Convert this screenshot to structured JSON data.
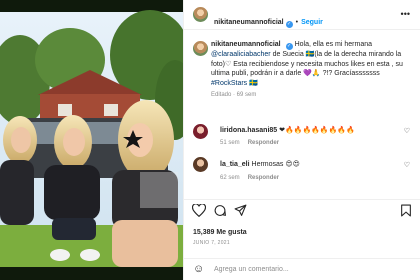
{
  "post": {
    "username": "nikitaneumannoficial",
    "follow_label": "Seguir",
    "more_label": "•••",
    "caption_prefix": "Hola, ella es mi hermana",
    "caption_mention": "@claraaliciabacher",
    "caption_rest": "de Suecia 🇸🇪(la de la derecha mirando la foto)♡ Esta recibiendose y necesita muchos likes en esta , su ultima publi, podrán ir a darle 💜🙏 ?!? Gracíasssssss",
    "caption_hashtag": "#RockStars",
    "caption_end": "🇸🇪",
    "edited": "Editado · 69 sem"
  },
  "comments": [
    {
      "username": "liridona.hasani85",
      "text": "❤🔥🔥🔥🔥🔥🔥🔥🔥",
      "time": "51 sem",
      "reply_label": "Responder"
    },
    {
      "username": "la_tia_eli",
      "text": "Hermosas 😍😍",
      "time": "62 sem",
      "reply_label": "Responder"
    }
  ],
  "likes": "15,389 Me gusta",
  "date": "JUNIO 7, 2021",
  "add_comment_placeholder": "Agrega un comentario...",
  "icons": {
    "like": "heart-icon",
    "comment": "comment-icon",
    "share": "share-icon",
    "emoji": "emoji-icon",
    "verified": "verified-badge-icon"
  },
  "colors": {
    "follow": "#0095f6",
    "verified": "#3897f0",
    "secondary_text": "#8e8e8e"
  }
}
